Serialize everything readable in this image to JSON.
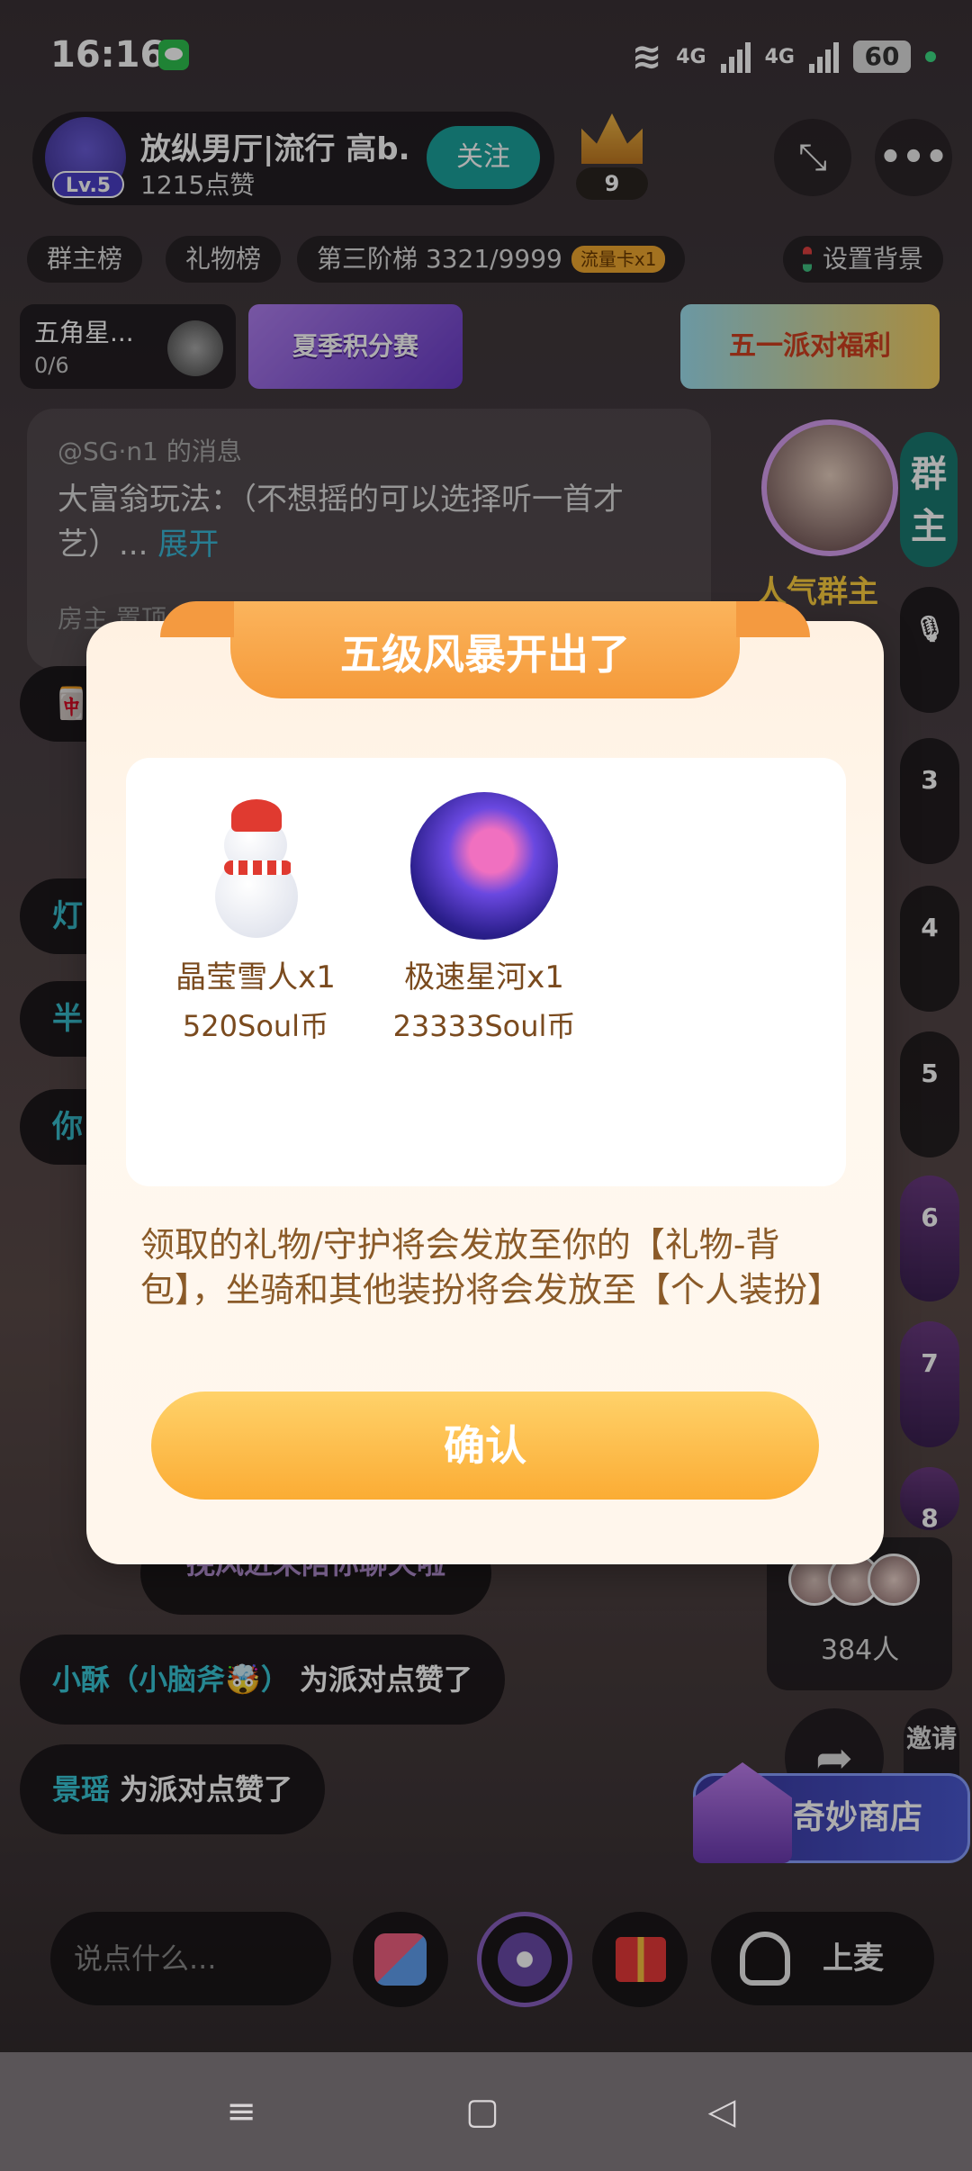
{
  "status_bar": {
    "time": "16:16",
    "network_1": "4G",
    "network_2": "4G",
    "battery": "60"
  },
  "header": {
    "room_title": "放纵男厅|流行 高b...",
    "likes": "1215点赞",
    "level": "Lv.5",
    "follow_label": "关注",
    "crown_count": "9"
  },
  "tabs": {
    "group_rank": "群主榜",
    "gift_rank": "礼物榜",
    "ladder": "第三阶梯 3321/9999",
    "flow_card": "流量卡x1",
    "set_background": "设置背景"
  },
  "banners": {
    "star_title": "五角星...",
    "star_progress": "0/6",
    "summer": "夏季积分赛",
    "party": "五一派对福利"
  },
  "message": {
    "from": "@SG·n1 的消息",
    "body": "大富翁玩法：（不想摇的可以选择听一首才艺）...",
    "expand": "展开",
    "footer": "房主 置顶"
  },
  "side_bubbles": [
    "灯",
    "半",
    "你"
  ],
  "host": {
    "tag": "人气群主",
    "group_label": "群主"
  },
  "mic_slots": [
    "3",
    "4",
    "5",
    "6",
    "7",
    "8"
  ],
  "audience": {
    "count": "384人"
  },
  "chat": {
    "greeting": "挽风进来陪你聊天啦",
    "line1_name": "小酥（小脑斧",
    "line1_emoji": "🤯",
    "line1_close": "）",
    "line1_text": " 为派对点赞了",
    "line2_name": "景瑶",
    "line2_text": " 为派对点赞了"
  },
  "actions": {
    "invite": "邀请",
    "shop": "奇妙商店",
    "input_placeholder": "说点什么...",
    "mic_label": "上麦"
  },
  "modal": {
    "title": "五级风暴开出了",
    "rewards": [
      {
        "name": "晶莹雪人x1",
        "price": "520Soul币"
      },
      {
        "name": "极速星河x1",
        "price": "23333Soul币"
      }
    ],
    "note": "领取的礼物/守护将会发放至你的【礼物-背包】，坐骑和其他装扮将会发放至【个人装扮】",
    "confirm": "确认"
  },
  "nav": {
    "menu_icon": "≡",
    "home_icon": "▢",
    "back_icon": "◁"
  }
}
